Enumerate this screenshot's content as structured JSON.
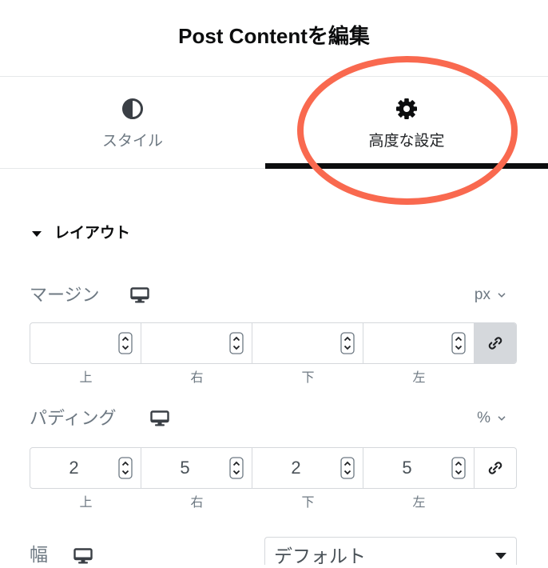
{
  "colors": {
    "heading": "#0c0d0e",
    "text-dark": "#1f2124",
    "text-muted": "#6d7882",
    "text-value": "#495157",
    "icon": "#3a3f45",
    "border": "#d5d8dc",
    "divider": "#e6e8ea",
    "link-active-bg": "#d5d8dc",
    "annotation": "#f9694f",
    "background": "#ffffff"
  },
  "header": {
    "title": "Post Contentを編集"
  },
  "tabs": [
    {
      "label": "スタイル",
      "icon": "contrast-icon",
      "active": false
    },
    {
      "label": "高度な設定",
      "icon": "gear-icon",
      "active": true
    }
  ],
  "layout_section": {
    "title": "レイアウト",
    "expanded": true
  },
  "margin": {
    "label": "マージン",
    "device_icon": "desktop-icon",
    "unit": "px",
    "values": [
      "",
      "",
      "",
      ""
    ],
    "sides": [
      "上",
      "右",
      "下",
      "左"
    ],
    "linked": true
  },
  "padding": {
    "label": "パディング",
    "device_icon": "desktop-icon",
    "unit": "%",
    "values": [
      "2",
      "5",
      "2",
      "5"
    ],
    "sides": [
      "上",
      "右",
      "下",
      "左"
    ],
    "linked": false
  },
  "width": {
    "label": "幅",
    "device_icon": "desktop-icon",
    "selected": "デフォルト"
  }
}
